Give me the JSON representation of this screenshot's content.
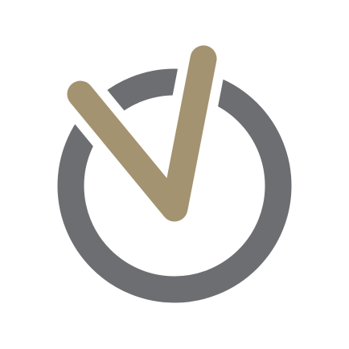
{
  "logo": {
    "icon": "clock-check-icon",
    "colors": {
      "background": "#ffffff",
      "ring": "#6d6e71",
      "check": "#a39370",
      "gap": "#ffffff"
    }
  }
}
